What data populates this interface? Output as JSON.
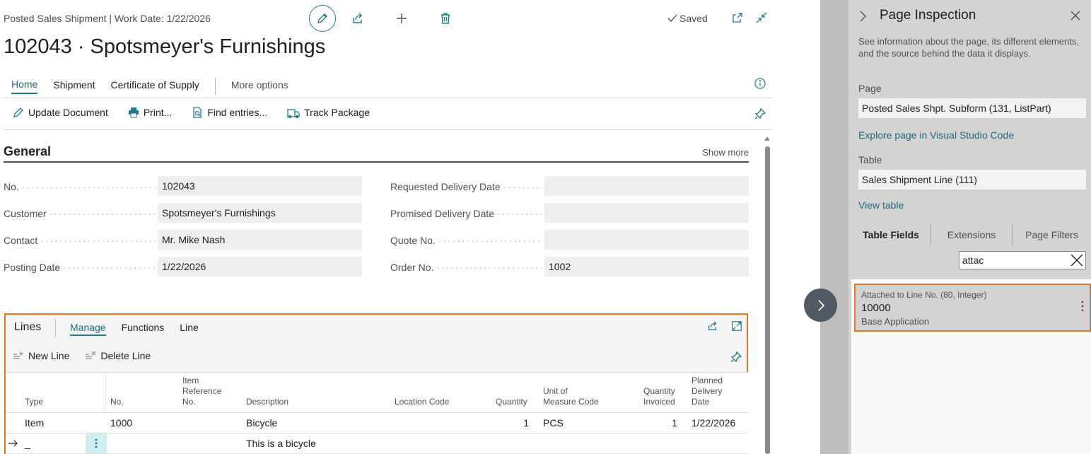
{
  "header": {
    "caption": "Posted Sales Shipment | Work Date: 1/22/2026",
    "saved": "Saved",
    "title": "102043 · Spotsmeyer's Furnishings"
  },
  "tabs": [
    "Home",
    "Shipment",
    "Certificate of Supply",
    "More options"
  ],
  "actions": [
    "Update Document",
    "Print...",
    "Find entries...",
    "Track Package"
  ],
  "general": {
    "title": "General",
    "show_more": "Show more",
    "left_fields": [
      {
        "label": "No.",
        "value": "102043"
      },
      {
        "label": "Customer",
        "value": "Spotsmeyer's Furnishings"
      },
      {
        "label": "Contact",
        "value": "Mr. Mike Nash"
      },
      {
        "label": "Posting Date",
        "value": "1/22/2026"
      }
    ],
    "right_fields": [
      {
        "label": "Requested Delivery Date",
        "value": ""
      },
      {
        "label": "Promised Delivery Date",
        "value": ""
      },
      {
        "label": "Quote No.",
        "value": ""
      },
      {
        "label": "Order No.",
        "value": "1002"
      }
    ]
  },
  "lines": {
    "title": "Lines",
    "tabs": [
      "Manage",
      "Functions",
      "Line"
    ],
    "actions": [
      "New Line",
      "Delete Line"
    ],
    "columns": {
      "type": "Type",
      "no": "No.",
      "item_ref_1": "Item",
      "item_ref_2": "Reference",
      "item_ref_3": "No.",
      "description": "Description",
      "location": "Location Code",
      "quantity": "Quantity",
      "uom_1": "Unit of",
      "uom_2": "Measure Code",
      "qinv_1": "Quantity",
      "qinv_2": "Invoiced",
      "pdd_1": "Planned",
      "pdd_2": "Delivery",
      "pdd_3": "Date"
    },
    "rows": [
      {
        "type": "Item",
        "no": "1000",
        "description": "Bicycle",
        "quantity": "1",
        "uom": "PCS",
        "qinv": "1",
        "pdd": "1/22/2026"
      },
      {
        "type": "_",
        "no": "",
        "description": "This is a bicycle",
        "quantity": "",
        "uom": "",
        "qinv": "",
        "pdd": ""
      }
    ]
  },
  "inspection": {
    "title": "Page Inspection",
    "description": "See information about the page, its different elements, and the source behind the data it displays.",
    "page_label": "Page",
    "page_value": "Posted Sales Shpt. Subform (131, ListPart)",
    "explore_link": "Explore page in Visual Studio Code",
    "table_label": "Table",
    "table_value": "Sales Shipment Line (111)",
    "view_table": "View table",
    "tabs": [
      "Table Fields",
      "Extensions",
      "Page Filters"
    ],
    "search_value": "attac",
    "field_card": {
      "name": "Attached to Line No. (80, Integer)",
      "value": "10000",
      "source": "Base Application"
    }
  }
}
